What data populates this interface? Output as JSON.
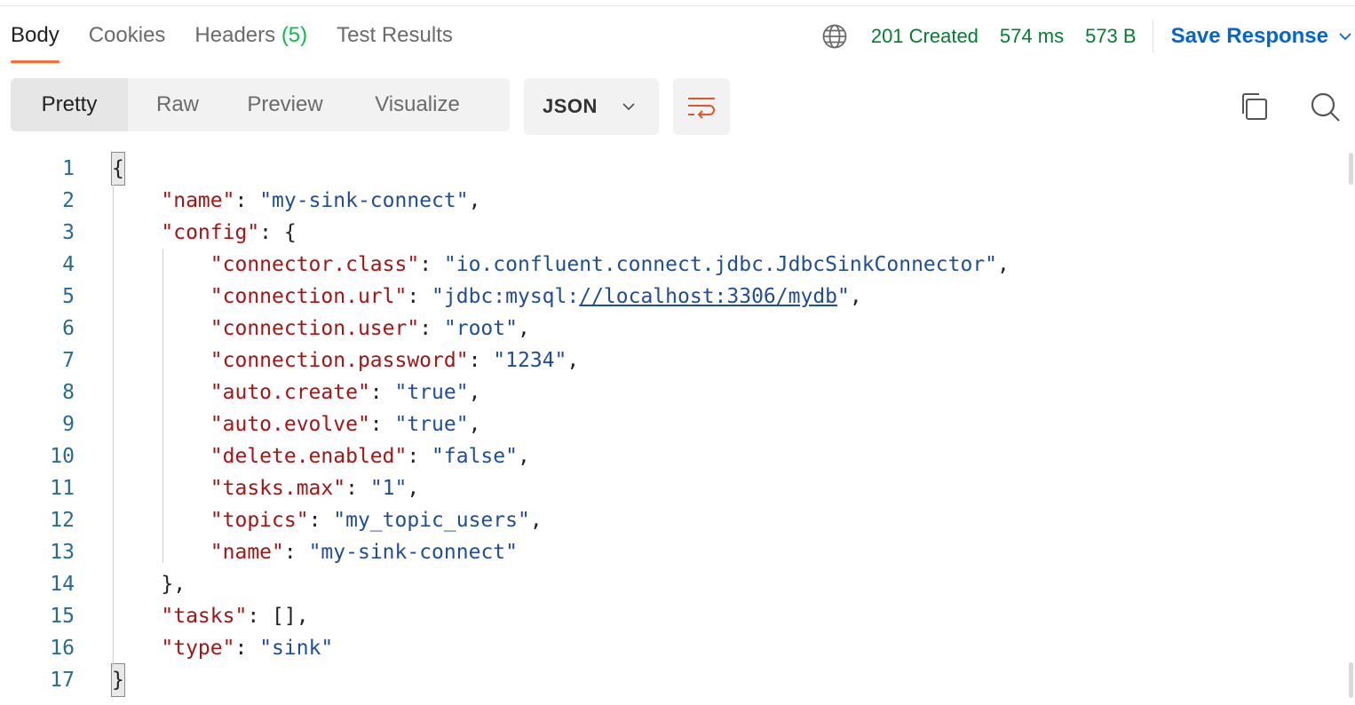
{
  "tabs": [
    {
      "label": "Body"
    },
    {
      "label": "Cookies"
    },
    {
      "label": "Headers",
      "count": "(5)"
    },
    {
      "label": "Test Results"
    }
  ],
  "status": {
    "code": "201 Created",
    "time": "574 ms",
    "size": "573 B",
    "colors": {
      "ok": "#007f31",
      "link": "#0265d2",
      "accent": "#ff6c37"
    }
  },
  "save_response_label": "Save Response",
  "view_modes": [
    "Pretty",
    "Raw",
    "Preview",
    "Visualize"
  ],
  "format_selector": {
    "value": "JSON"
  },
  "icons": [
    "globe-icon",
    "chevron-down-icon",
    "wrap-lines-icon",
    "copy-icon",
    "search-icon"
  ],
  "editor": {
    "line_numbers": [
      "1",
      "2",
      "3",
      "4",
      "5",
      "6",
      "7",
      "8",
      "9",
      "10",
      "11",
      "12",
      "13",
      "14",
      "15",
      "16",
      "17"
    ],
    "lines": [
      {
        "indent": "",
        "tokens": [
          {
            "t": "{",
            "c": "brace-hl"
          }
        ]
      },
      {
        "indent": "    ",
        "tokens": [
          {
            "t": "\"name\"",
            "c": "k"
          },
          {
            "t": ": ",
            "c": "p"
          },
          {
            "t": "\"my-sink-connect\"",
            "c": "s"
          },
          {
            "t": ",",
            "c": "p"
          }
        ]
      },
      {
        "indent": "    ",
        "tokens": [
          {
            "t": "\"config\"",
            "c": "k"
          },
          {
            "t": ": {",
            "c": "p"
          }
        ]
      },
      {
        "indent": "        ",
        "tokens": [
          {
            "t": "\"connector.class\"",
            "c": "k"
          },
          {
            "t": ": ",
            "c": "p"
          },
          {
            "t": "\"io.confluent.connect.jdbc.JdbcSinkConnector\"",
            "c": "s"
          },
          {
            "t": ",",
            "c": "p"
          }
        ]
      },
      {
        "indent": "        ",
        "tokens": [
          {
            "t": "\"connection.url\"",
            "c": "k"
          },
          {
            "t": ": ",
            "c": "p"
          },
          {
            "t": "\"jdbc:mysql:",
            "c": "s"
          },
          {
            "t": "//localhost:3306/mydb",
            "c": "u"
          },
          {
            "t": "\"",
            "c": "s"
          },
          {
            "t": ",",
            "c": "p"
          }
        ]
      },
      {
        "indent": "        ",
        "tokens": [
          {
            "t": "\"connection.user\"",
            "c": "k"
          },
          {
            "t": ": ",
            "c": "p"
          },
          {
            "t": "\"root\"",
            "c": "s"
          },
          {
            "t": ",",
            "c": "p"
          }
        ]
      },
      {
        "indent": "        ",
        "tokens": [
          {
            "t": "\"connection.password\"",
            "c": "k"
          },
          {
            "t": ": ",
            "c": "p"
          },
          {
            "t": "\"1234\"",
            "c": "s"
          },
          {
            "t": ",",
            "c": "p"
          }
        ]
      },
      {
        "indent": "        ",
        "tokens": [
          {
            "t": "\"auto.create\"",
            "c": "k"
          },
          {
            "t": ": ",
            "c": "p"
          },
          {
            "t": "\"true\"",
            "c": "s"
          },
          {
            "t": ",",
            "c": "p"
          }
        ]
      },
      {
        "indent": "        ",
        "tokens": [
          {
            "t": "\"auto.evolve\"",
            "c": "k"
          },
          {
            "t": ": ",
            "c": "p"
          },
          {
            "t": "\"true\"",
            "c": "s"
          },
          {
            "t": ",",
            "c": "p"
          }
        ]
      },
      {
        "indent": "        ",
        "tokens": [
          {
            "t": "\"delete.enabled\"",
            "c": "k"
          },
          {
            "t": ": ",
            "c": "p"
          },
          {
            "t": "\"false\"",
            "c": "s"
          },
          {
            "t": ",",
            "c": "p"
          }
        ]
      },
      {
        "indent": "        ",
        "tokens": [
          {
            "t": "\"tasks.max\"",
            "c": "k"
          },
          {
            "t": ": ",
            "c": "p"
          },
          {
            "t": "\"1\"",
            "c": "s"
          },
          {
            "t": ",",
            "c": "p"
          }
        ]
      },
      {
        "indent": "        ",
        "tokens": [
          {
            "t": "\"topics\"",
            "c": "k"
          },
          {
            "t": ": ",
            "c": "p"
          },
          {
            "t": "\"my_topic_users\"",
            "c": "s"
          },
          {
            "t": ",",
            "c": "p"
          }
        ]
      },
      {
        "indent": "        ",
        "tokens": [
          {
            "t": "\"name\"",
            "c": "k"
          },
          {
            "t": ": ",
            "c": "p"
          },
          {
            "t": "\"my-sink-connect\"",
            "c": "s"
          }
        ]
      },
      {
        "indent": "    ",
        "tokens": [
          {
            "t": "},",
            "c": "p"
          }
        ]
      },
      {
        "indent": "    ",
        "tokens": [
          {
            "t": "\"tasks\"",
            "c": "k"
          },
          {
            "t": ": [],",
            "c": "p"
          }
        ]
      },
      {
        "indent": "    ",
        "tokens": [
          {
            "t": "\"type\"",
            "c": "k"
          },
          {
            "t": ": ",
            "c": "p"
          },
          {
            "t": "\"sink\"",
            "c": "s"
          }
        ]
      },
      {
        "indent": "",
        "tokens": [
          {
            "t": "}",
            "c": "brace-hl"
          }
        ]
      }
    ]
  }
}
